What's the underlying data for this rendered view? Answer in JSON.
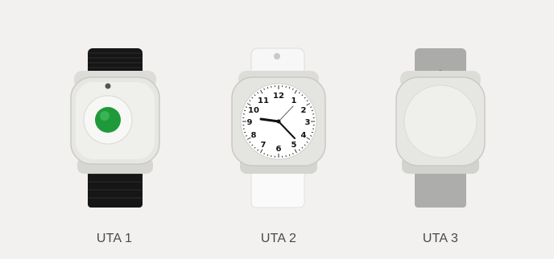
{
  "products": [
    {
      "label": "UTA 1",
      "strap_color": "#151515",
      "accent": "#1e9a3a"
    },
    {
      "label": "UTA 2",
      "strap_color": "#f4f4f4",
      "dial_numbers": [
        "12",
        "1",
        "2",
        "3",
        "4",
        "5",
        "6",
        "7",
        "8",
        "9",
        "10",
        "11"
      ]
    },
    {
      "label": "UTA 3",
      "strap_color": "#a9a9a7"
    }
  ],
  "icons": {
    "device_1": "pendant-button-wrist-device",
    "device_2": "wrist-watch-device",
    "device_3": "plain-wrist-device"
  }
}
